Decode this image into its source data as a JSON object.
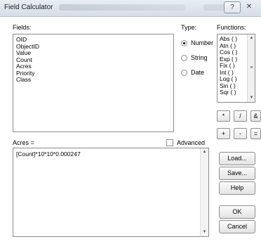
{
  "window": {
    "title": "Field Calculator",
    "help_button": "?",
    "close_button": "✕"
  },
  "fields": {
    "label": "Fields:",
    "items": [
      "OID",
      "ObjectID",
      "Value",
      "Count",
      "Acres",
      "Priority",
      "Class"
    ]
  },
  "type": {
    "label": "Type:",
    "options": [
      {
        "label": "Number",
        "selected": true
      },
      {
        "label": "String",
        "selected": false
      },
      {
        "label": "Date",
        "selected": false
      }
    ]
  },
  "functions": {
    "label": "Functions:",
    "items": [
      "Abs ( )",
      "Atn ( )",
      "Cos ( )",
      "Exp ( )",
      "Fix ( )",
      "Int ( )",
      "Log ( )",
      "Sin ( )",
      "Sqr ( )"
    ]
  },
  "operators": {
    "multiply": "*",
    "divide": "/",
    "ampersand": "&",
    "plus": "+",
    "minus": "-",
    "equals": "="
  },
  "expression": {
    "label": "Acres =",
    "value": "[Count]*10*10*0.000247",
    "advanced_label": "Advanced",
    "advanced_checked": false
  },
  "buttons": {
    "load": "Load...",
    "save": "Save...",
    "help": "Help",
    "ok": "OK",
    "cancel": "Cancel"
  }
}
